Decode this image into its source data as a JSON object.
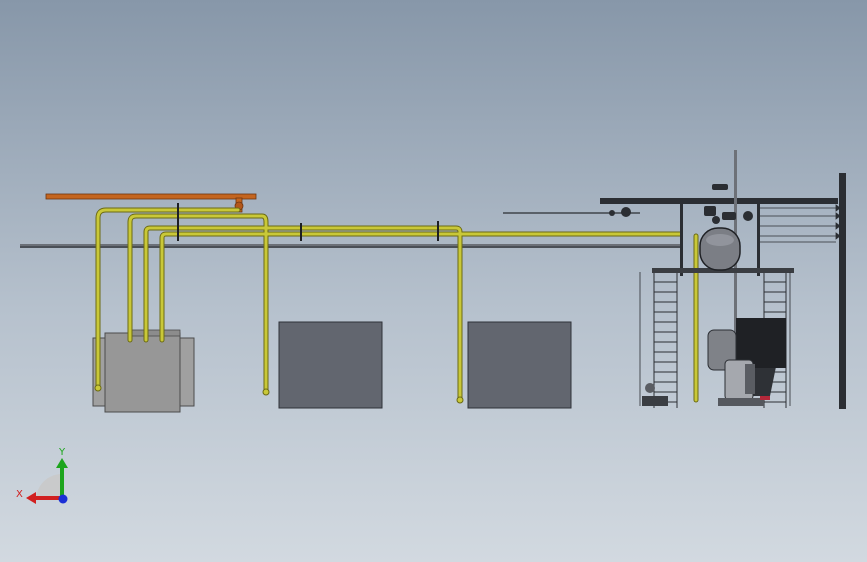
{
  "viewport": {
    "background_top": "#8797a9",
    "background_bottom": "#d2d9e0"
  },
  "colors": {
    "yellow_pipe": "#c9c838",
    "yellow_pipe_edge": "#6b6a14",
    "orange_pipe": "#c4651f",
    "grey_pipe": "#4a4f57",
    "tank_dark": "#62666f",
    "tank_light": "#9a9a9a",
    "frame": "#2b2e33"
  },
  "triad": {
    "x_label": "X",
    "y_label": "Y",
    "x_color": "#d11f1f",
    "y_color": "#1da51d",
    "z_color": "#1b2fd6"
  }
}
